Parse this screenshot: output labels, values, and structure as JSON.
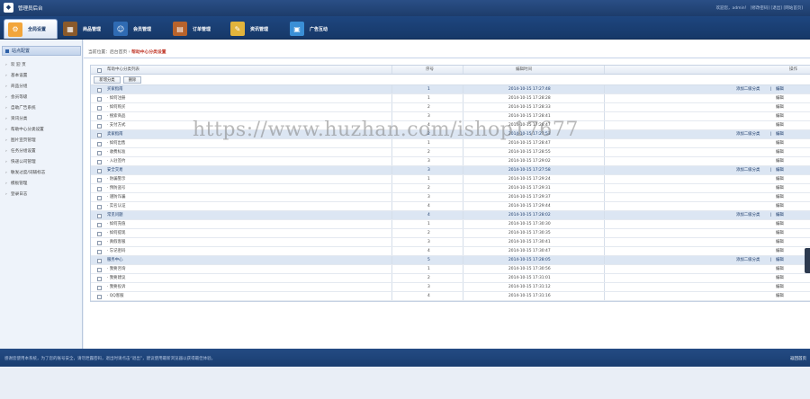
{
  "app": {
    "logo_icon": "logo-icon",
    "title": "管理员后台",
    "user_info": "欢迎您，admin！ [修改密码] [退出] [网站首页]"
  },
  "nav": {
    "items": [
      {
        "label": "全局设置",
        "icon": "globe-icon",
        "active": true
      },
      {
        "label": "商品管理",
        "icon": "box-icon"
      },
      {
        "label": "会员管理",
        "icon": "member-icon"
      },
      {
        "label": "订单管理",
        "icon": "order-icon"
      },
      {
        "label": "资讯管理",
        "icon": "news-icon"
      },
      {
        "label": "广告互动",
        "icon": "ad-icon"
      }
    ]
  },
  "sidebar": {
    "header": "站点配置",
    "items": [
      "欢 迎 页",
      "基本设置",
      "商品分组",
      "会员等级",
      "自助广告系统",
      "资讯分类",
      "帮助中心分类设置",
      "图片宣页管理",
      "任务分组设置",
      "快递公司管理",
      "敏发过度/词辅标志",
      "模板管理",
      "登录日志"
    ]
  },
  "breadcrumb": {
    "prefix": "当前位置：后台首页 › ",
    "current": "帮助中心分类设置"
  },
  "table": {
    "headers": {
      "name": "帮助中心分类列表",
      "order": "序号",
      "time": "编辑时间",
      "action": "操作"
    },
    "add_button": "新增分类",
    "delete_button": "删除",
    "add_child_label": "添加二级分类",
    "edit_label": "编辑",
    "rows": [
      {
        "type": "cat",
        "name": "买家指南",
        "order": "1",
        "time": "2014-10-15 17:27:48"
      },
      {
        "type": "sub",
        "name": "· 如何注册",
        "order": "1",
        "time": "2014-10-15 17:28:28"
      },
      {
        "type": "sub",
        "name": "· 如何购买",
        "order": "2",
        "time": "2014-10-15 17:28:33"
      },
      {
        "type": "sub",
        "name": "· 搜索商品",
        "order": "3",
        "time": "2014-10-15 17:28:41"
      },
      {
        "type": "sub",
        "name": "· 支付方式",
        "order": "4",
        "time": "2014-10-15 17:28:47"
      },
      {
        "type": "cat",
        "name": "卖家指南",
        "order": "2",
        "time": "2014-10-15 17:27:53"
      },
      {
        "type": "sub",
        "name": "· 如何出售",
        "order": "1",
        "time": "2014-10-15 17:28:47"
      },
      {
        "type": "sub",
        "name": "· 收费标准",
        "order": "2",
        "time": "2014-10-15 17:28:55"
      },
      {
        "type": "sub",
        "name": "· 入驻签约",
        "order": "3",
        "time": "2014-10-15 17:29:02"
      },
      {
        "type": "cat",
        "name": "安全交易",
        "order": "3",
        "time": "2014-10-15 17:27:58"
      },
      {
        "type": "sub",
        "name": "· 防骗警示",
        "order": "1",
        "time": "2014-10-15 17:29:24"
      },
      {
        "type": "sub",
        "name": "· 预防盗号",
        "order": "2",
        "time": "2014-10-15 17:29:31"
      },
      {
        "type": "sub",
        "name": "· 谨防诈骗",
        "order": "3",
        "time": "2014-10-15 17:29:37"
      },
      {
        "type": "sub",
        "name": "· 实名认证",
        "order": "4",
        "time": "2014-10-15 17:29:44"
      },
      {
        "type": "cat",
        "name": "常见问题",
        "order": "4",
        "time": "2014-10-15 17:28:02"
      },
      {
        "type": "sub",
        "name": "· 如何充值",
        "order": "1",
        "time": "2014-10-15 17:30:30"
      },
      {
        "type": "sub",
        "name": "· 如何提现",
        "order": "2",
        "time": "2014-10-15 17:30:35"
      },
      {
        "type": "sub",
        "name": "· 真假客服",
        "order": "3",
        "time": "2014-10-15 17:30:41"
      },
      {
        "type": "sub",
        "name": "· 忘记密码",
        "order": "4",
        "time": "2014-10-15 17:30:47"
      },
      {
        "type": "cat",
        "name": "服务中心",
        "order": "5",
        "time": "2014-10-15 17:28:05"
      },
      {
        "type": "sub",
        "name": "· 我要咨询",
        "order": "1",
        "time": "2014-10-15 17:30:56"
      },
      {
        "type": "sub",
        "name": "· 我要建议",
        "order": "2",
        "time": "2014-10-15 17:31:01"
      },
      {
        "type": "sub",
        "name": "· 我要投诉",
        "order": "3",
        "time": "2014-10-15 17:31:12"
      },
      {
        "type": "sub",
        "name": "· QQ客服",
        "order": "4",
        "time": "2014-10-15 17:31:16"
      }
    ]
  },
  "footer": {
    "text": "感谢您使用本系统，为了您的账号安全，请勿泄露密码，退出时请点击“退出”，建议使用最新浏览器以获得最佳体验。",
    "back": "返回首页"
  },
  "watermark": "https://www.huzhan.com/ishop17677",
  "colors": {
    "nav_bg": "#1e467f",
    "category_row": "#dce6f3",
    "breadcrumb_current": "#c0392b"
  }
}
